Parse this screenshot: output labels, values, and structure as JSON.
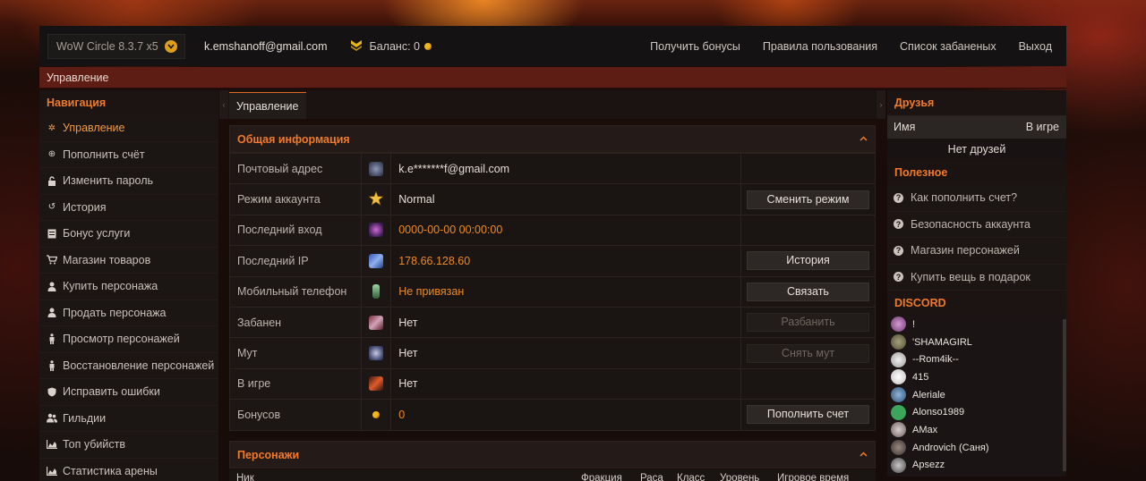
{
  "topbar": {
    "realm": "WoW Circle 8.3.7 x5",
    "email": "k.emshanoff@gmail.com",
    "balance_label": "Баланс: 0",
    "links": [
      "Получить бонусы",
      "Правила пользования",
      "Список забаненых",
      "Выход"
    ]
  },
  "breadcrumb": "Управление",
  "nav": {
    "title": "Навигация",
    "items": [
      {
        "label": "Управление",
        "icon": "gear-icon"
      },
      {
        "label": "Пополнить счёт",
        "icon": "plus-circle-icon"
      },
      {
        "label": "Изменить пароль",
        "icon": "lock-icon"
      },
      {
        "label": "История",
        "icon": "history-icon"
      },
      {
        "label": "Бонус услуги",
        "icon": "list-icon"
      },
      {
        "label": "Магазин товаров",
        "icon": "cart-icon"
      },
      {
        "label": "Купить персонажа",
        "icon": "user-icon"
      },
      {
        "label": "Продать персонажа",
        "icon": "user-icon"
      },
      {
        "label": "Просмотр персонажей",
        "icon": "male-icon"
      },
      {
        "label": "Восстановление персонажей",
        "icon": "male-icon"
      },
      {
        "label": "Исправить ошибки",
        "icon": "shield-icon"
      },
      {
        "label": "Гильдии",
        "icon": "users-icon"
      },
      {
        "label": "Топ убийств",
        "icon": "chart-icon"
      },
      {
        "label": "Статистика арены",
        "icon": "chart-icon"
      }
    ]
  },
  "tab": "Управление",
  "info": {
    "title": "Общая информация",
    "rows": [
      {
        "label": "Почтовый адрес",
        "value": "k.e*******f@gmail.com",
        "button": ""
      },
      {
        "label": "Режим аккаунта",
        "value": "Normal",
        "button": "Сменить режим"
      },
      {
        "label": "Последний вход",
        "value": "0000-00-00 00:00:00",
        "button": ""
      },
      {
        "label": "Последний IP",
        "value": "178.66.128.60",
        "button": "История"
      },
      {
        "label": "Мобильный телефон",
        "value": "Не привязан",
        "button": "Связать"
      },
      {
        "label": "Забанен",
        "value": "Нет",
        "button": "Разбанить"
      },
      {
        "label": "Мут",
        "value": "Нет",
        "button": "Снять мут"
      },
      {
        "label": "В игре",
        "value": "Нет",
        "button": ""
      },
      {
        "label": "Бонусов",
        "value": "0",
        "button": "Пополнить счет"
      }
    ]
  },
  "characters": {
    "title": "Персонажи",
    "columns": [
      "Ник",
      "Фракция",
      "Раса",
      "Класс",
      "Уровень",
      "Игровое время"
    ]
  },
  "friends": {
    "title": "Друзья",
    "col_name": "Имя",
    "col_ingame": "В игре",
    "empty": "Нет друзей"
  },
  "useful": {
    "title": "Полезное",
    "items": [
      "Как пополнить счет?",
      "Безопасность аккаунта",
      "Магазин персонажей",
      "Купить вещь в подарок"
    ]
  },
  "discord": {
    "title": "DISCORD",
    "members": [
      "!",
      "'SHAMAGIRL",
      "--Rom4ik--",
      "415",
      "Aleriale",
      "Alonso1989",
      "AMax",
      "Androvich (Саня)",
      "Apsezz"
    ]
  },
  "colors": {
    "accent": "#f07a2a",
    "value_orange": "#ee8a25",
    "breadcrumb_bg": "#5e1d14"
  }
}
